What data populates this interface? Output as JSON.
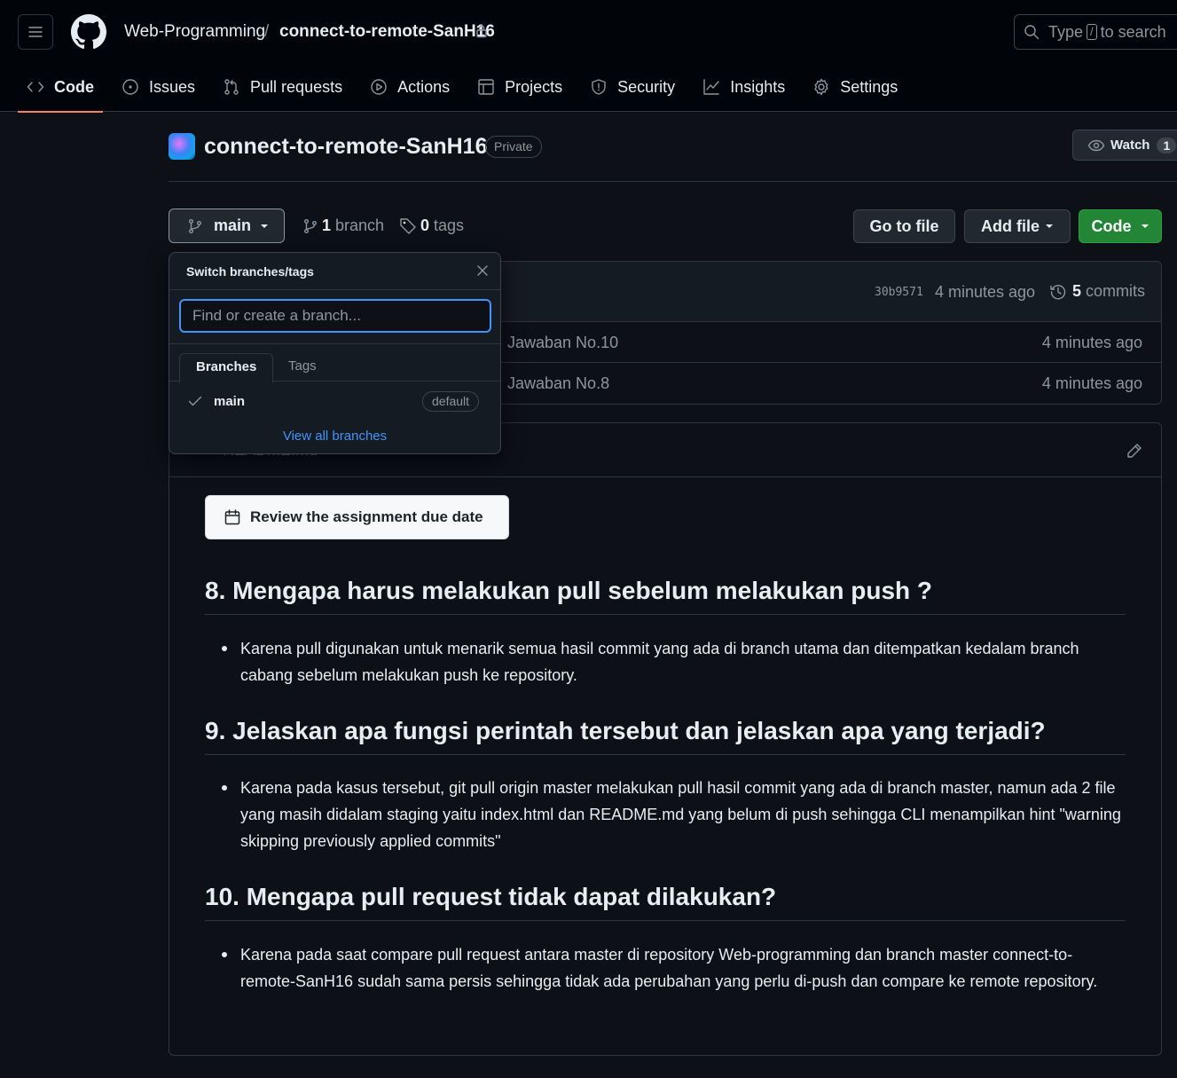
{
  "header": {
    "owner": "Web-Programming",
    "separator": "/",
    "repo": "connect-to-remote-SanH16",
    "search": {
      "prefix": "Type",
      "key": "/",
      "suffix": "to search"
    }
  },
  "nav": {
    "items": [
      {
        "label": "Code",
        "icon": "code-icon",
        "active": true
      },
      {
        "label": "Issues",
        "icon": "issue-icon"
      },
      {
        "label": "Pull requests",
        "icon": "pull-request-icon"
      },
      {
        "label": "Actions",
        "icon": "play-icon"
      },
      {
        "label": "Projects",
        "icon": "table-icon"
      },
      {
        "label": "Security",
        "icon": "shield-icon"
      },
      {
        "label": "Insights",
        "icon": "graph-icon"
      },
      {
        "label": "Settings",
        "icon": "gear-icon"
      }
    ]
  },
  "repo": {
    "name": "connect-to-remote-SanH16",
    "visibility": "Private",
    "watch_label": "Watch",
    "watch_count": "1"
  },
  "branch_bar": {
    "current_branch": "main",
    "branch_count": "1",
    "branch_label": "branch",
    "tag_count": "0",
    "tag_label": "tags",
    "go_to_file": "Go to file",
    "add_file": "Add file",
    "code": "Code"
  },
  "latest_commit": {
    "sha": "30b9571",
    "time": "4 minutes ago",
    "commit_count": "5",
    "commit_label": "commits"
  },
  "files": [
    {
      "message": "Jawaban No.10",
      "age": "4 minutes ago"
    },
    {
      "message": "Jawaban No.8",
      "age": "4 minutes ago"
    }
  ],
  "readme": {
    "title": "README.md",
    "due_button": "Review the assignment due date",
    "sections": [
      {
        "heading": "8. Mengapa harus melakukan pull sebelum melakukan push ?",
        "text": "Karena pull digunakan untuk menarik semua hasil commit yang ada di branch utama dan ditempatkan kedalam branch cabang sebelum melakukan push ke repository."
      },
      {
        "heading": "9. Jelaskan apa fungsi perintah tersebut dan jelaskan apa yang terjadi?",
        "text": "Karena pada kasus tersebut, git pull origin master melakukan pull hasil commit yang ada di branch master, namun ada 2 file yang masih didalam staging yaitu index.html dan README.md yang belum di push sehingga CLI menampilkan hint \"warning skipping previously applied commits\""
      },
      {
        "heading": "10. Mengapa pull request tidak dapat dilakukan?",
        "text": "Karena pada saat compare pull request antara master di repository Web-programming dan branch master connect-to-remote-SanH16 sudah sama persis sehingga tidak ada perubahan yang perlu di-push dan compare ke remote repository."
      }
    ]
  },
  "branch_dropdown": {
    "title": "Switch branches/tags",
    "placeholder": "Find or create a branch...",
    "tabs": [
      "Branches",
      "Tags"
    ],
    "branch": {
      "name": "main",
      "badge": "default"
    },
    "footer": "View all branches"
  },
  "colors": {
    "background": "#0d1117",
    "header": "#010409",
    "accent_underline": "#f78166",
    "link": "#4493f8",
    "primary_button": "#238636"
  }
}
